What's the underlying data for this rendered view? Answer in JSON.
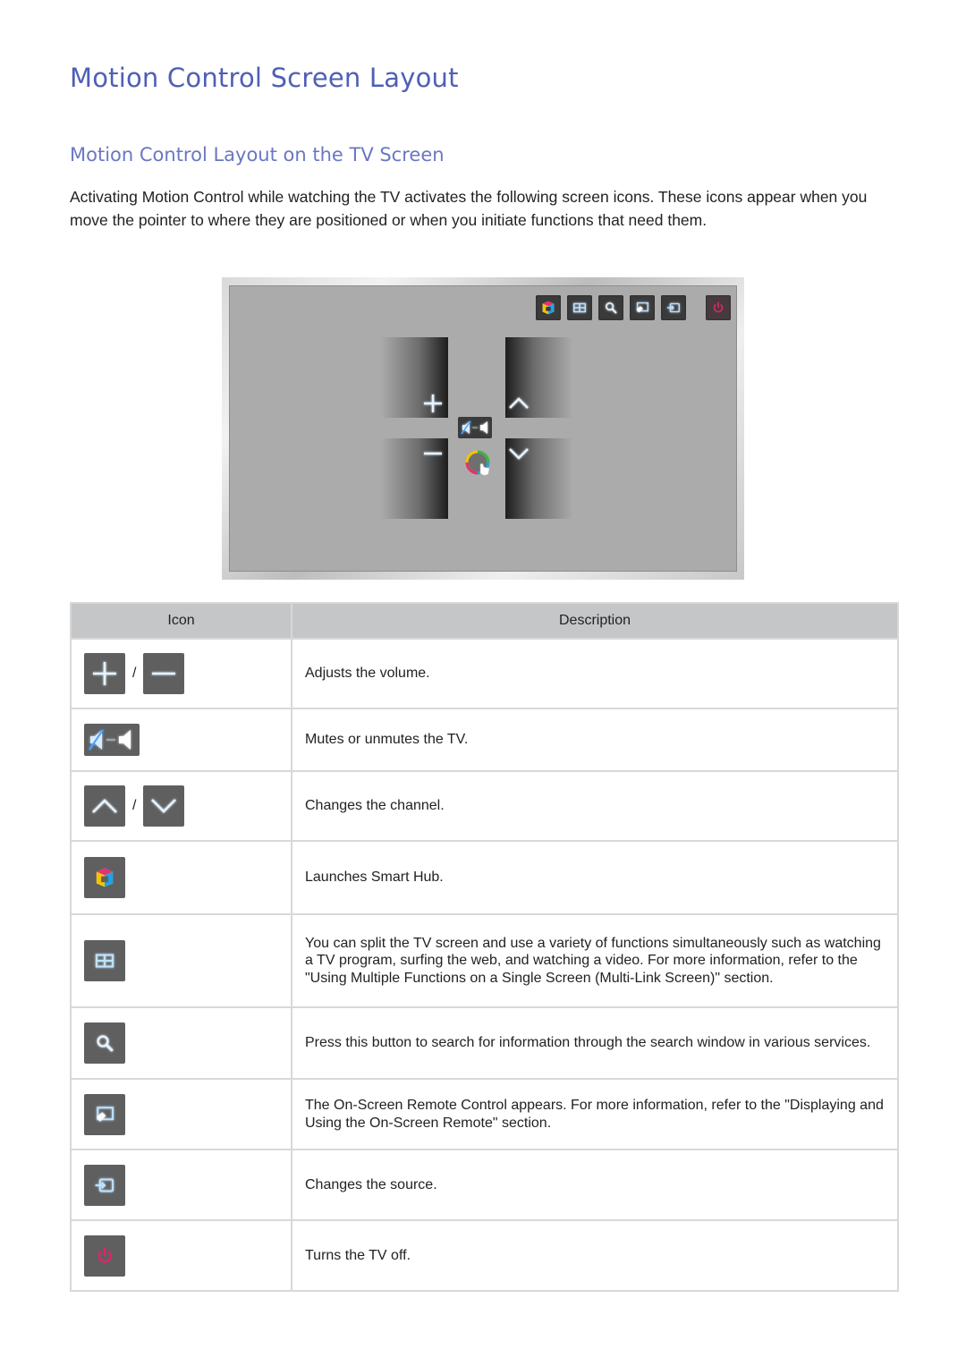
{
  "page": {
    "title": "Motion Control Screen Layout",
    "section_title": "Motion Control Layout on the TV Screen",
    "intro": "Activating Motion Control while watching the TV activates the following screen icons. These icons appear when you move the pointer to where they are positioned or when you initiate functions that need them."
  },
  "tv_figure": {
    "top_bar_icons": [
      "smart-hub-icon",
      "multi-link-screen-icon",
      "search-icon",
      "on-screen-remote-icon",
      "source-icon",
      "power-icon"
    ],
    "center_icons": [
      "volume-up-icon",
      "volume-down-icon",
      "channel-up-icon",
      "channel-down-icon",
      "mute-toggle-icon",
      "pointer-icon"
    ]
  },
  "colors": {
    "title": "#4f5fb5",
    "section_title": "#6a77c2",
    "icon_glow": "#4aa3ff",
    "power": "#e0246b",
    "icon_bg": "#5f5f5f",
    "table_header_bg": "#c5c6c8"
  },
  "table": {
    "headers": {
      "icon": "Icon",
      "description": "Description"
    },
    "separator": "/",
    "rows": [
      {
        "icons": [
          "volume-up-icon",
          "volume-down-icon"
        ],
        "description": "Adjusts the volume."
      },
      {
        "icons": [
          "mute-toggle-icon"
        ],
        "description": "Mutes or unmutes the TV."
      },
      {
        "icons": [
          "channel-up-icon",
          "channel-down-icon"
        ],
        "description": "Changes the channel."
      },
      {
        "icons": [
          "smart-hub-icon"
        ],
        "description": "Launches Smart Hub."
      },
      {
        "icons": [
          "multi-link-screen-icon"
        ],
        "description": "You can split the TV screen and use a variety of functions simultaneously such as watching a TV program, surfing the web, and watching a video. For more information, refer to the \"Using Multiple Functions on a Single Screen (Multi-Link Screen)\" section."
      },
      {
        "icons": [
          "search-icon"
        ],
        "description": "Press this button to search for information through the search window in various services."
      },
      {
        "icons": [
          "on-screen-remote-icon"
        ],
        "description": "The On-Screen Remote Control appears. For more information, refer to the \"Displaying and Using the On-Screen Remote\" section."
      },
      {
        "icons": [
          "source-icon"
        ],
        "description": "Changes the source."
      },
      {
        "icons": [
          "power-icon"
        ],
        "description": "Turns the TV off."
      }
    ]
  }
}
